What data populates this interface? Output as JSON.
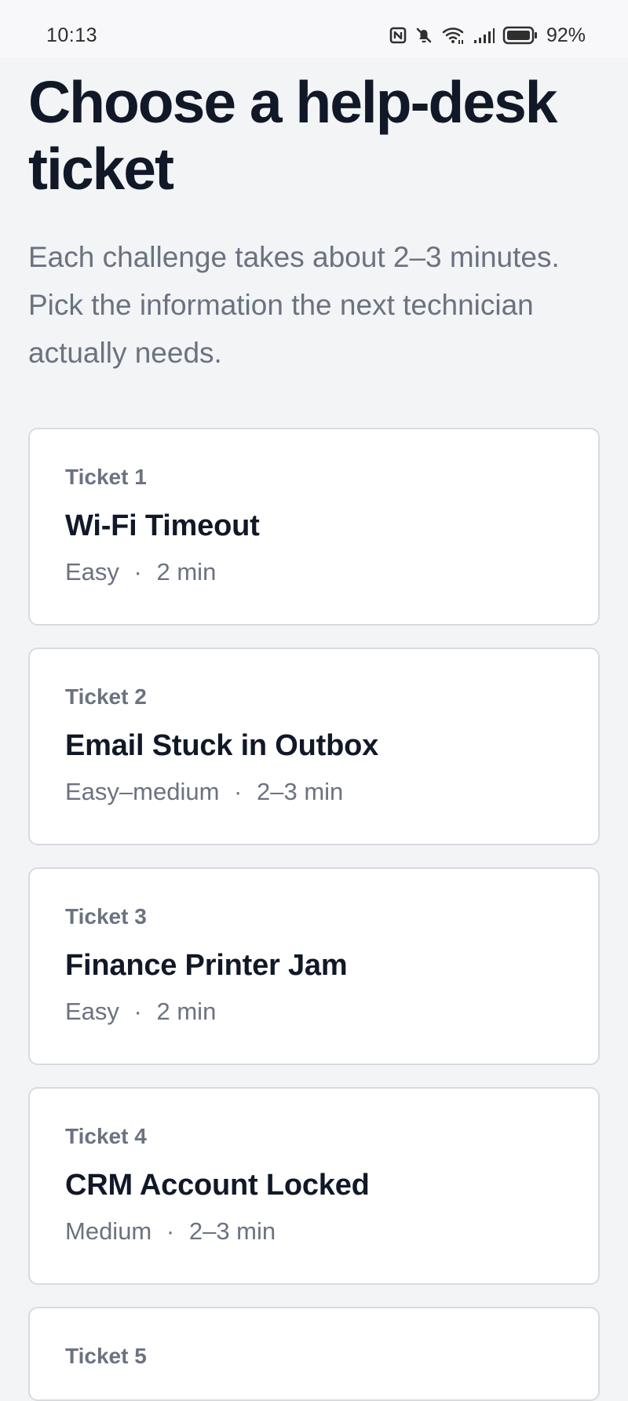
{
  "status_bar": {
    "time": "10:13",
    "battery_percent": "92%",
    "icons": [
      "nfc-icon",
      "mute-icon",
      "wifi-icon",
      "signal-icon",
      "battery-icon"
    ]
  },
  "page": {
    "title": "Choose a help-desk ticket",
    "subtitle": "Each challenge takes about 2–3 minutes. Pick the information the next technician actually needs."
  },
  "tickets": [
    {
      "label": "Ticket 1",
      "title": "Wi-Fi Timeout",
      "difficulty": "Easy",
      "separator": "·",
      "duration": "2 min"
    },
    {
      "label": "Ticket 2",
      "title": "Email Stuck in Outbox",
      "difficulty": "Easy–medium",
      "separator": "·",
      "duration": "2–3 min"
    },
    {
      "label": "Ticket 3",
      "title": "Finance Printer Jam",
      "difficulty": "Easy",
      "separator": "·",
      "duration": "2 min"
    },
    {
      "label": "Ticket 4",
      "title": "CRM Account Locked",
      "difficulty": "Medium",
      "separator": "·",
      "duration": "2–3 min"
    },
    {
      "label": "Ticket 5"
    }
  ]
}
